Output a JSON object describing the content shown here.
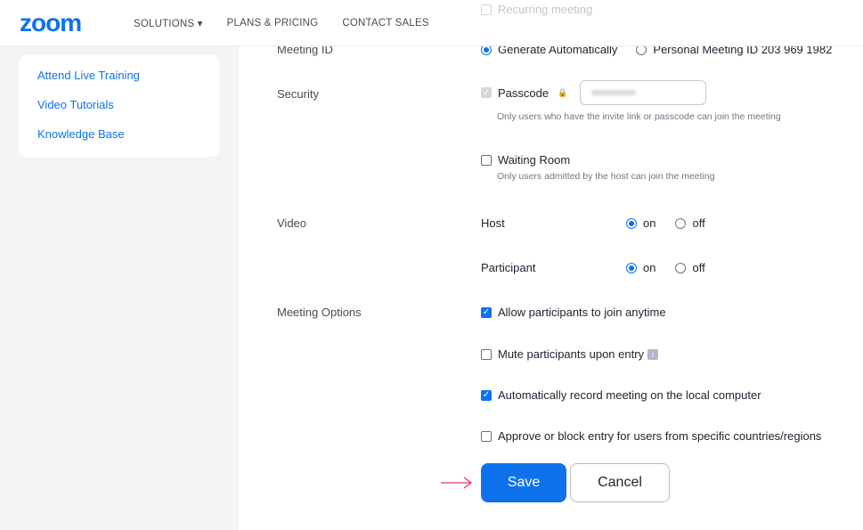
{
  "header": {
    "logo": "zoom",
    "nav": [
      "SOLUTIONS ▾",
      "PLANS & PRICING",
      "CONTACT SALES"
    ]
  },
  "sidebar": {
    "links": [
      "Attend Live Training",
      "Video Tutorials",
      "Knowledge Base"
    ]
  },
  "form": {
    "recurring": "Recurring meeting",
    "meeting_id": {
      "label": "Meeting ID",
      "opt1": "Generate Automatically",
      "opt2": "Personal Meeting ID 203 969 1982",
      "selected": "Generate Automatically"
    },
    "security": {
      "label": "Security",
      "passcode": "Passcode",
      "passcode_hint": "Only users who have the invite link or passcode can join the meeting",
      "waiting_room": "Waiting Room",
      "waiting_hint": "Only users admitted by the host can join the meeting",
      "waiting_checked": false
    },
    "video": {
      "label": "Video",
      "host": "Host",
      "participant": "Participant",
      "on": "on",
      "off": "off",
      "host_value": "on",
      "participant_value": "on"
    },
    "options": {
      "label": "Meeting Options",
      "items": [
        {
          "text": "Allow participants to join anytime",
          "checked": true
        },
        {
          "text": "Mute participants upon entry",
          "checked": false
        },
        {
          "text": "Automatically record meeting on the local computer",
          "checked": true
        },
        {
          "text": "Approve or block entry for users from specific countries/regions",
          "checked": false
        }
      ]
    },
    "save": "Save",
    "cancel": "Cancel"
  },
  "colors": {
    "accent": "#0e72ed",
    "arrow": "#e8336b"
  }
}
